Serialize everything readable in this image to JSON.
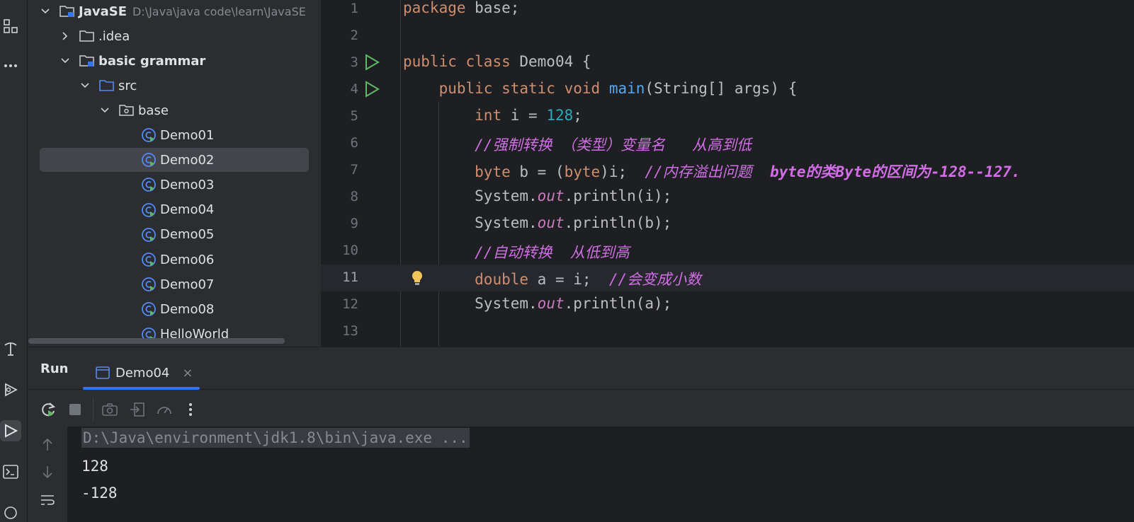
{
  "project_tree": {
    "root": {
      "label": "JavaSE",
      "path": "D:\\Java\\java code\\learn\\JavaSE"
    },
    "idea": {
      "label": ".idea"
    },
    "module": {
      "label": "basic grammar"
    },
    "src": {
      "label": "src"
    },
    "package": {
      "label": "base"
    },
    "classes": [
      "Demo01",
      "Demo02",
      "Demo03",
      "Demo04",
      "Demo05",
      "Demo06",
      "Demo07",
      "Demo08",
      "HelloWorld"
    ],
    "selected_class": "Demo02"
  },
  "editor": {
    "current_line": 11,
    "line_numbers": [
      "1",
      "2",
      "3",
      "4",
      "5",
      "6",
      "7",
      "8",
      "9",
      "10",
      "11",
      "12",
      "13"
    ],
    "lines": {
      "l1_kw": "package",
      "l1_rest": " base;",
      "l3_kw1": "public",
      "l3_kw2": "class",
      "l3_rest": " Demo04 {",
      "l4_indent": "    ",
      "l4_kw1": "public",
      "l4_kw2": "static",
      "l4_kw3": "void",
      "l4_fn": "main",
      "l4_rest": "(String[] args) {",
      "l5_indent": "        ",
      "l5_kw": "int",
      "l5_mid": " i = ",
      "l5_num": "128",
      "l5_end": ";",
      "l6_indent": "        ",
      "l6_cm": "//强制转换 （类型）变量名   从高到低",
      "l7_indent": "        ",
      "l7_kw": "byte",
      "l7_mid": " b = (",
      "l7_kw2": "byte",
      "l7_end": ")i;  ",
      "l7_cm": "//内存溢出问题  ",
      "l7_cmb": "byte的类Byte的区间为-128--127.",
      "l8_indent": "        ",
      "l8_a": "System.",
      "l8_st": "out",
      "l8_b": ".println(i);",
      "l9_indent": "        ",
      "l9_a": "System.",
      "l9_st": "out",
      "l9_b": ".println(b);",
      "l10_indent": "        ",
      "l10_cm": "//自动转换  从低到高",
      "l11_indent": "        ",
      "l11_kw": "double",
      "l11_mid": " a = i;  ",
      "l11_cm": "//会变成小数",
      "l12_indent": "        ",
      "l12_a": "System.",
      "l12_st": "out",
      "l12_b": ".println(a);"
    }
  },
  "run_panel": {
    "title": "Run",
    "tab_label": "Demo04",
    "tab_close": "×",
    "output": [
      "D:\\Java\\environment\\jdk1.8\\bin\\java.exe ...",
      "128",
      "-128"
    ]
  },
  "colors": {
    "accent": "#3574f0",
    "keyword": "#cf8e6d",
    "number": "#2aacb8",
    "method": "#56a8f5",
    "comment": "#d16ee6",
    "run_green": "#5fb865"
  },
  "icons": [
    "apps-icon",
    "more-icon",
    "tree-icon",
    "run-services-icon",
    "run-icon",
    "terminal-icon",
    "rerun-icon",
    "stop-icon",
    "camera-icon",
    "import-icon",
    "profiler-icon",
    "kebab-icon",
    "up-arrow-icon",
    "down-arrow-icon",
    "soft-wrap-icon",
    "bulb-icon"
  ]
}
